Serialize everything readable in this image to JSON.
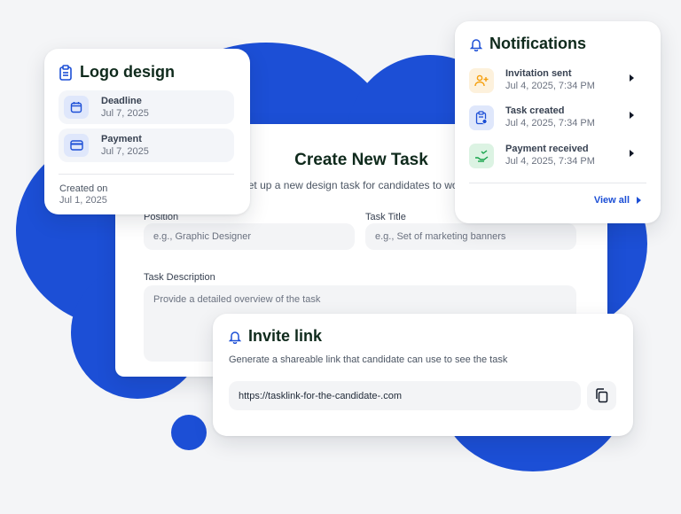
{
  "colors": {
    "accent": "#1c4fd6",
    "background": "#f4f5f7",
    "title": "#0f2a1c"
  },
  "task_form": {
    "title": "Create New Task",
    "subtitle": "Set up a new design task for candidates to work on",
    "position": {
      "label": "Position",
      "placeholder": "e.g., Graphic Designer"
    },
    "task_title": {
      "label": "Task Title",
      "placeholder": "e.g., Set of marketing banners"
    },
    "description": {
      "label": "Task Description",
      "placeholder": "Provide a detailed overview of the task"
    }
  },
  "logo_card": {
    "icon": "clipboard-icon",
    "title": "Logo design",
    "items": [
      {
        "icon": "calendar-icon",
        "label": "Deadline",
        "value": "Jul 7, 2025"
      },
      {
        "icon": "credit-card-icon",
        "label": "Payment",
        "value": "Jul 7, 2025"
      }
    ],
    "created_label": "Created on",
    "created_value": "Jul 1, 2025"
  },
  "notifications": {
    "icon": "bell-icon",
    "title": "Notifications",
    "items": [
      {
        "icon": "user-add-icon",
        "icon_color": "#f59e0b",
        "icon_bg": "#fdf1dc",
        "title": "Invitation sent",
        "time": "Jul 4, 2025, 7:34 PM"
      },
      {
        "icon": "clipboard-clock-icon",
        "icon_color": "#1c4fd6",
        "icon_bg": "#dfe7fb",
        "title": "Task created",
        "time": "Jul 4, 2025, 7:34 PM"
      },
      {
        "icon": "money-hand-icon",
        "icon_color": "#16a34a",
        "icon_bg": "#dcf3e3",
        "title": "Payment received",
        "time": "Jul 4, 2025, 7:34 PM"
      }
    ],
    "view_all": "View all"
  },
  "invite": {
    "icon": "bell-icon",
    "title": "Invite link",
    "subtitle": "Generate a shareable link that candidate can use to see the task",
    "link": "https://tasklink-for-the-candidate-.com",
    "copy_icon": "copy-icon"
  }
}
